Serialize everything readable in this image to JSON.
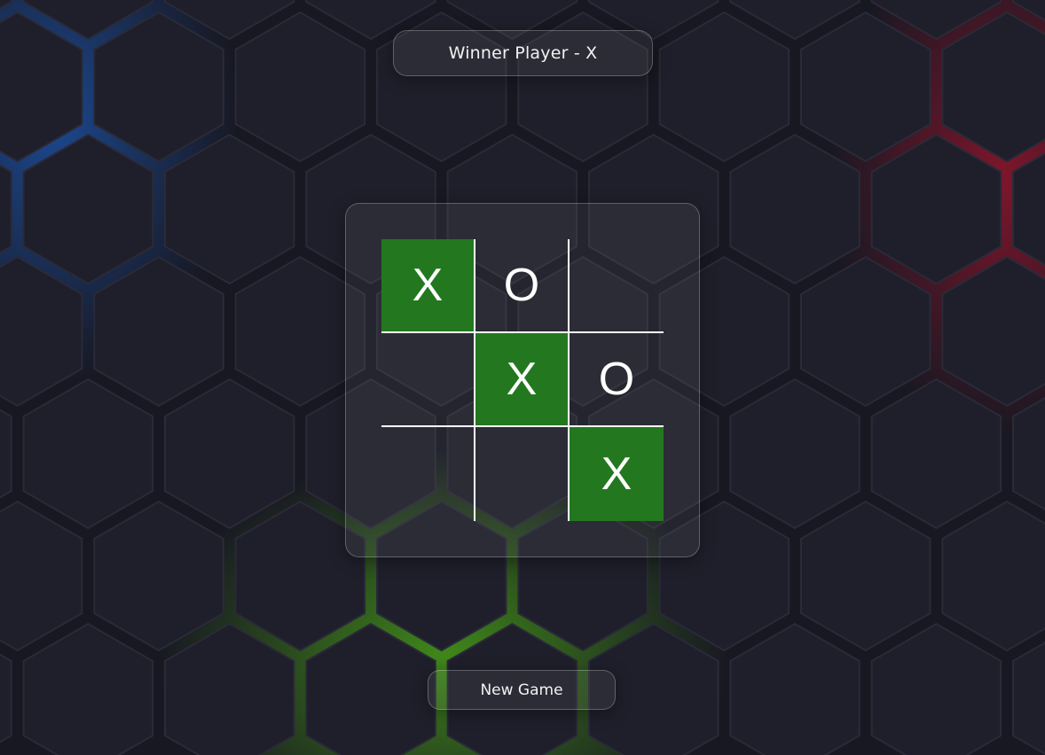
{
  "status": {
    "text": "Winner Player - X"
  },
  "board": {
    "cells": [
      {
        "mark": "X",
        "winning": true
      },
      {
        "mark": "O",
        "winning": false
      },
      {
        "mark": "",
        "winning": false
      },
      {
        "mark": "",
        "winning": false
      },
      {
        "mark": "X",
        "winning": true
      },
      {
        "mark": "O",
        "winning": false
      },
      {
        "mark": "",
        "winning": false
      },
      {
        "mark": "",
        "winning": false
      },
      {
        "mark": "X",
        "winning": true
      }
    ]
  },
  "controls": {
    "new_game_label": "New Game"
  },
  "colors": {
    "background": "#181822",
    "winning_cell": "#23781f",
    "grid_lines": "#ffffff",
    "glow_blue": "#1e6ee6",
    "glow_red": "#d21432",
    "glow_green": "#5ad214"
  }
}
